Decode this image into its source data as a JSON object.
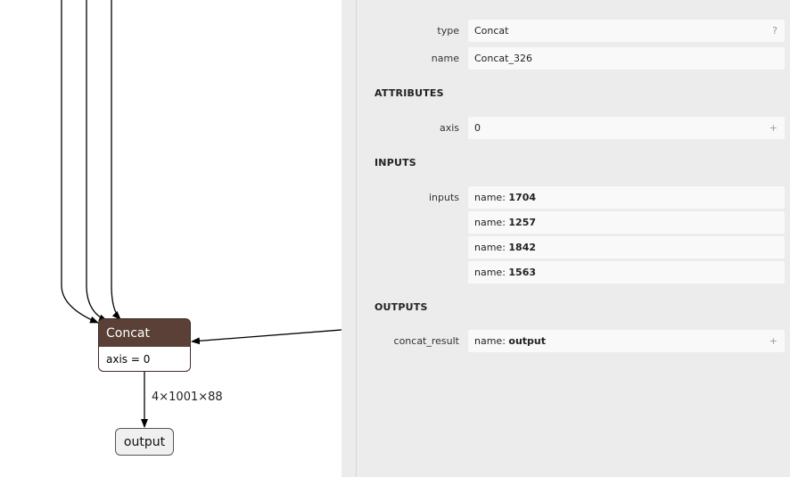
{
  "graph": {
    "node": {
      "title": "Concat",
      "attribute": "axis = 0"
    },
    "edge_label": "4×1001×88",
    "output_node": "output"
  },
  "properties": {
    "type": {
      "label": "type",
      "value": "Concat",
      "tag": "?"
    },
    "name": {
      "label": "name",
      "value": "Concat_326"
    },
    "attributes_header": "ATTRIBUTES",
    "axis": {
      "label": "axis",
      "value": "0",
      "tag": "+"
    },
    "inputs_header": "INPUTS",
    "inputs_label": "inputs",
    "inputs": [
      {
        "prefix": "name: ",
        "value": "1704"
      },
      {
        "prefix": "name: ",
        "value": "1257"
      },
      {
        "prefix": "name: ",
        "value": "1842"
      },
      {
        "prefix": "name: ",
        "value": "1563"
      }
    ],
    "outputs_header": "OUTPUTS",
    "output": {
      "label": "concat_result",
      "prefix": "name: ",
      "value": "output",
      "tag": "+"
    }
  },
  "colors": {
    "node_header": "#5a4037",
    "sidebar_bg": "#ececec",
    "field_bg": "#f9f9f9"
  }
}
